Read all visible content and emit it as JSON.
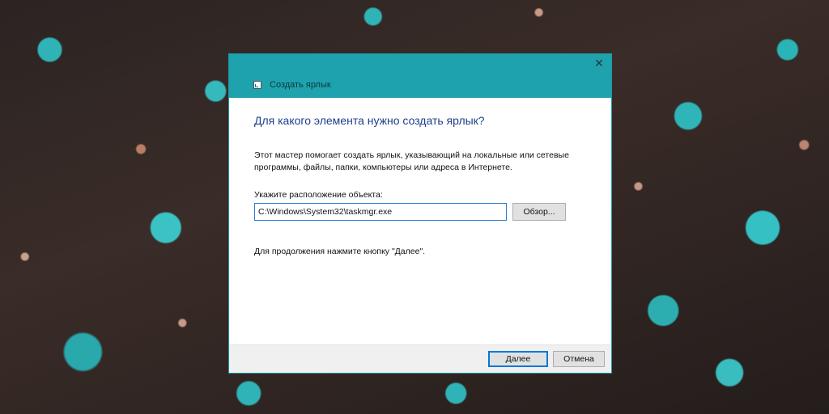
{
  "window": {
    "title": "Создать ярлык",
    "close_glyph": "✕",
    "icon": "shortcut-icon"
  },
  "wizard": {
    "heading": "Для какого элемента нужно создать ярлык?",
    "description": "Этот мастер помогает создать ярлык, указывающий на локальные или сетевые программы, файлы, папки, компьютеры или адреса в Интернете.",
    "location_label": "Укажите расположение объекта:",
    "location_value": "C:\\Windows\\System32\\taskmgr.exe",
    "browse_label": "Обзор...",
    "continue_hint": "Для продолжения нажмите кнопку \"Далее\"."
  },
  "footer": {
    "next_label": "Далее",
    "cancel_label": "Отмена"
  },
  "colors": {
    "titlebar": "#1ea3ae",
    "heading": "#1e3f8a",
    "focus_border": "#0078d7"
  }
}
